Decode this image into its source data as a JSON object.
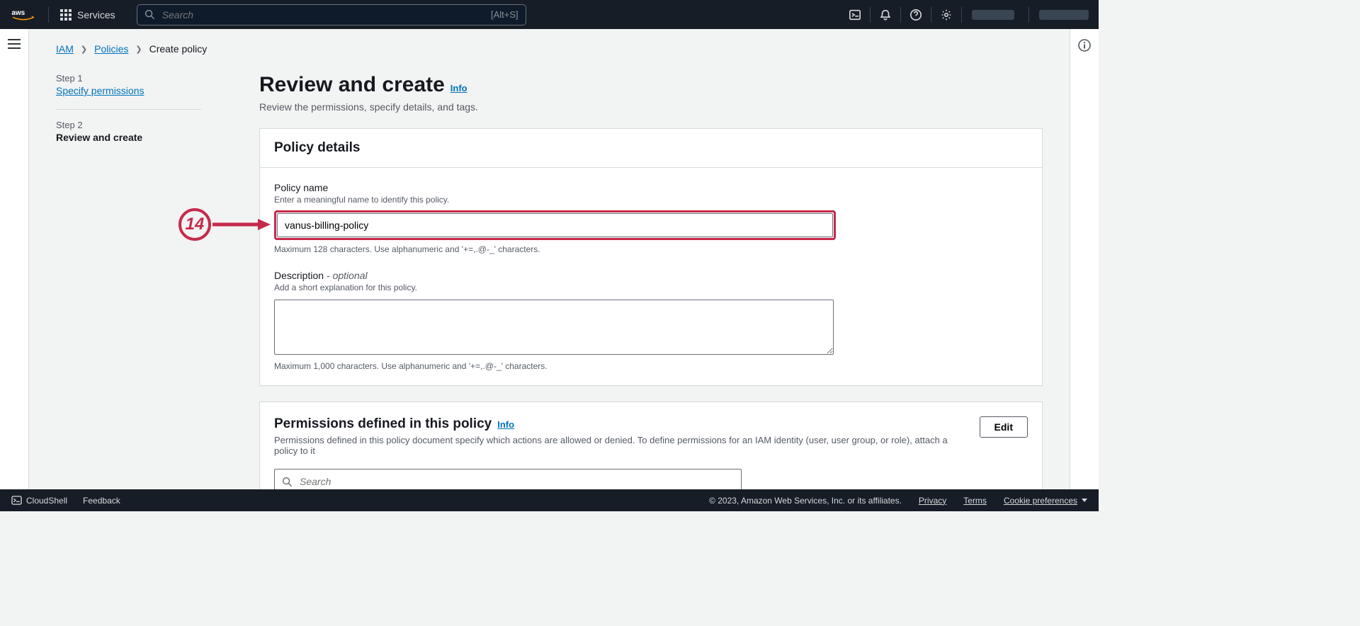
{
  "header": {
    "services_label": "Services",
    "search_placeholder": "Search",
    "search_shortcut": "[Alt+S]"
  },
  "breadcrumbs": {
    "root": "IAM",
    "policies": "Policies",
    "current": "Create policy"
  },
  "stepper": {
    "step1_num": "Step 1",
    "step1_label": "Specify permissions",
    "step2_num": "Step 2",
    "step2_label": "Review and create"
  },
  "page": {
    "title": "Review and create",
    "info": "Info",
    "subtitle": "Review the permissions, specify details, and tags."
  },
  "policy_details": {
    "panel_title": "Policy details",
    "name_label": "Policy name",
    "name_desc": "Enter a meaningful name to identify this policy.",
    "name_value": "vanus-billing-policy",
    "name_hint": "Maximum 128 characters. Use alphanumeric and '+=,.@-_' characters.",
    "desc_label": "Description",
    "desc_optional": "- optional",
    "desc_desc": "Add a short explanation for this policy.",
    "desc_value": "",
    "desc_hint": "Maximum 1,000 characters. Use alphanumeric and '+=,.@-_' characters."
  },
  "permissions": {
    "title": "Permissions defined in this policy",
    "info": "Info",
    "subtitle": "Permissions defined in this policy document specify which actions are allowed or denied. To define permissions for an IAM identity (user, user group, or role), attach a policy to it",
    "edit": "Edit",
    "search_placeholder": "Search"
  },
  "annotation": {
    "number": "14"
  },
  "footer": {
    "cloudshell": "CloudShell",
    "feedback": "Feedback",
    "copyright": "© 2023, Amazon Web Services, Inc. or its affiliates.",
    "privacy": "Privacy",
    "terms": "Terms",
    "cookies": "Cookie preferences"
  }
}
